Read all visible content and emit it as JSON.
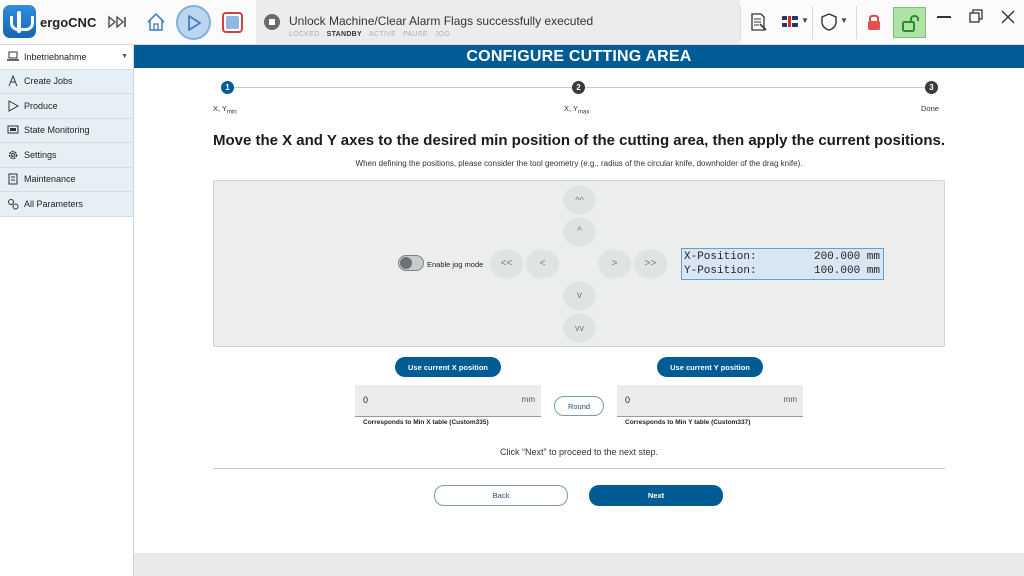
{
  "app": {
    "name": "ergoCNC"
  },
  "status": {
    "message": "Unlock Machine/Clear Alarm Flags successfully executed",
    "states": [
      {
        "label": "LOCKED",
        "active": false
      },
      {
        "label": "STANDBY",
        "active": true
      },
      {
        "label": "ACTIVE",
        "active": false
      },
      {
        "label": "PAUSE",
        "active": false
      },
      {
        "label": "JOG",
        "active": false
      }
    ]
  },
  "toolbar": {
    "icons": [
      "skip-icon",
      "home-icon",
      "play-icon",
      "stop-icon",
      "document-icon",
      "uk-flag-icon",
      "shield-icon",
      "lock-icon",
      "unlock-icon"
    ]
  },
  "sidebar": {
    "items": [
      {
        "label": "Inbetriebnahme",
        "icon": "laptop-icon"
      },
      {
        "label": "Create Jobs",
        "icon": "tool-icon"
      },
      {
        "label": "Produce",
        "icon": "play-outline-icon"
      },
      {
        "label": "State Monitoring",
        "icon": "monitor-icon"
      },
      {
        "label": "Settings",
        "icon": "gear-icon"
      },
      {
        "label": "Maintenance",
        "icon": "clipboard-icon"
      },
      {
        "label": "All Parameters",
        "icon": "gears-icon"
      }
    ]
  },
  "main": {
    "title": "CONFIGURE CUTTING AREA",
    "steps": [
      {
        "num": "1",
        "label": "X, Y",
        "sub": "min",
        "active": true
      },
      {
        "num": "2",
        "label": "X, Y",
        "sub": "max",
        "active": false
      },
      {
        "num": "3",
        "label": "Done",
        "sub": "",
        "active": false
      }
    ],
    "instruction": "Move the X and Y axes to the desired min position of the cutting area, then apply the current positions.",
    "hint": "When defining the positions, please consider the tool geometry (e.g., radius of the circular knife, downholder of the drag knife).",
    "jog": {
      "toggle_label": "Enable jog mode",
      "up_fast": "^^",
      "up": "^",
      "down": "v",
      "down_fast": "vv",
      "left_fast": "<<",
      "left": "<",
      "right": ">",
      "right_fast": ">>"
    },
    "position": {
      "x_label": "X-Position:",
      "x_value": "200.000 mm",
      "y_label": "Y-Position:",
      "y_value": "100.000 mm"
    },
    "use_x_label": "Use current X position",
    "use_y_label": "Use current Y position",
    "x_field": {
      "value": "0",
      "unit": "mm",
      "caption": "Corresponds to Min X table (Custom335)"
    },
    "y_field": {
      "value": "0",
      "unit": "mm",
      "caption": "Corresponds to Min Y table (Custom337)"
    },
    "round_label": "Round",
    "proceed_text": "Click “Next” to proceed to the next step.",
    "back_label": "Back",
    "next_label": "Next"
  }
}
